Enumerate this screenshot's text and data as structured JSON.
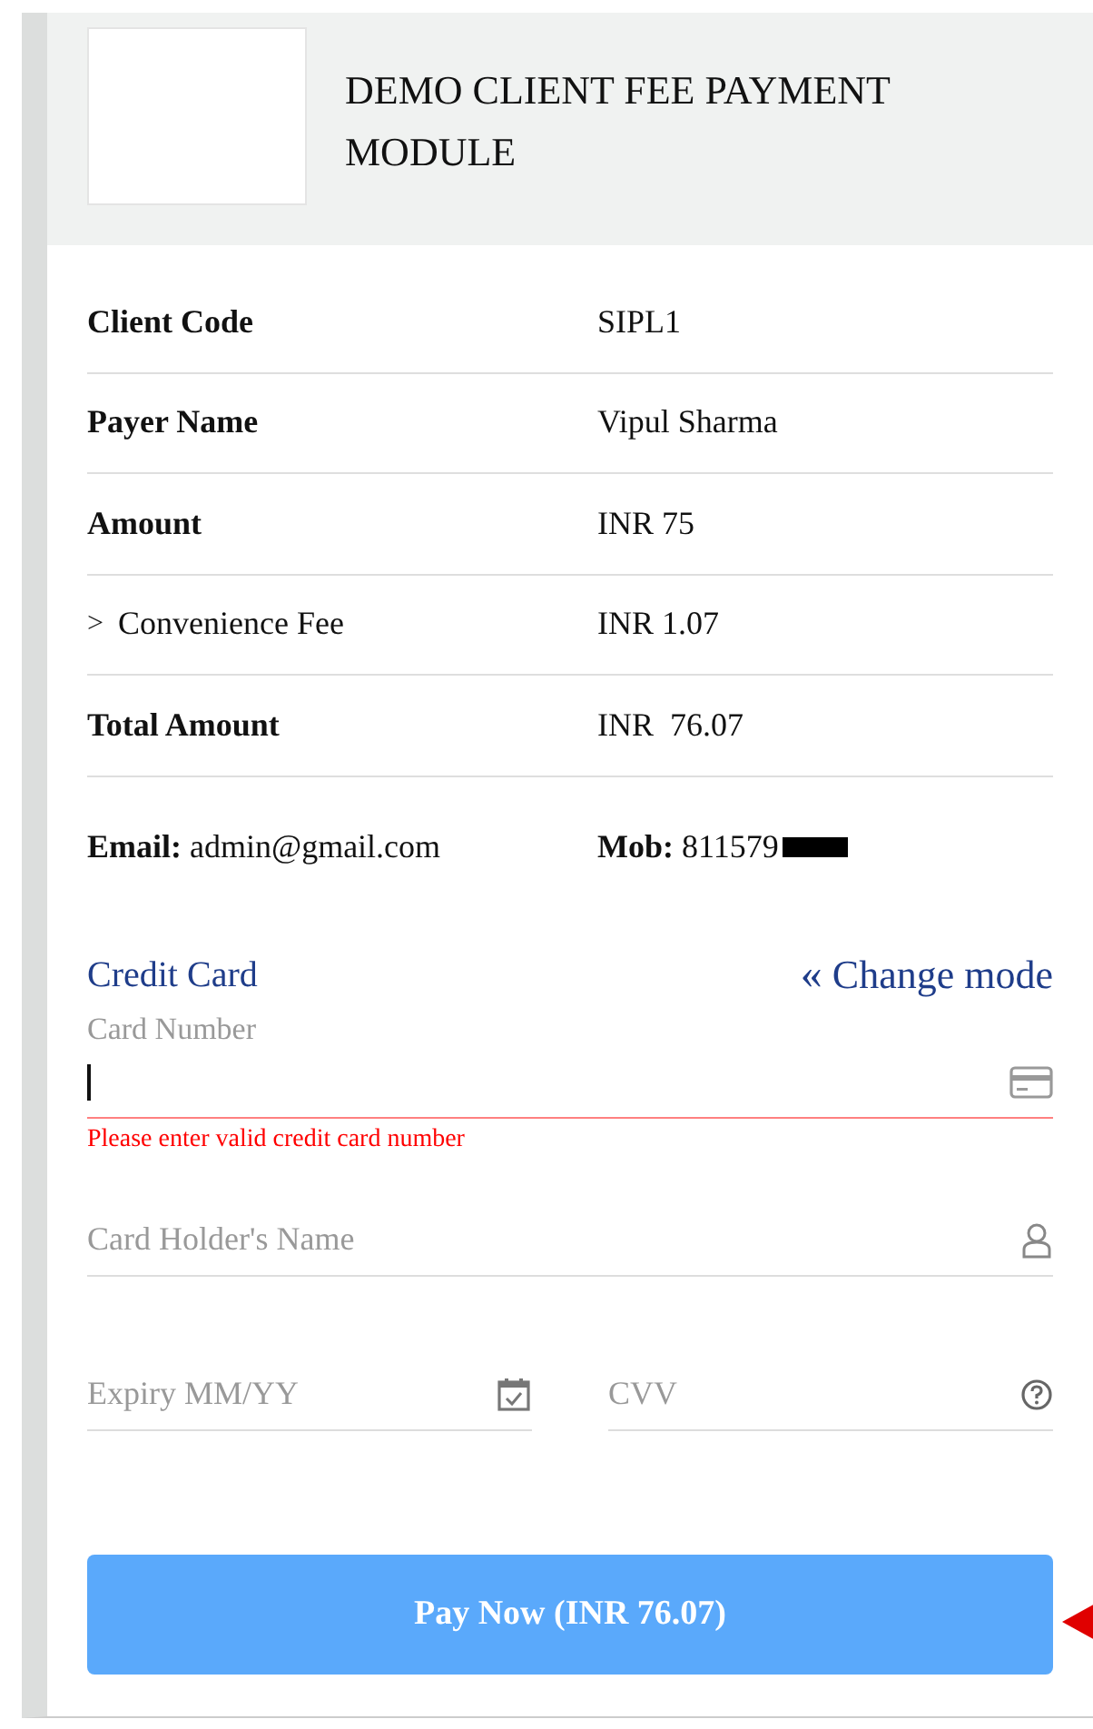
{
  "header": {
    "title": "DEMO CLIENT FEE PAYMENT MODULE"
  },
  "details": [
    {
      "kind": "plain",
      "label": "Client Code",
      "value": "SIPL1"
    },
    {
      "kind": "plain",
      "label": "Payer Name",
      "value": "Vipul Sharma"
    },
    {
      "kind": "plain",
      "label": "Amount",
      "value": "INR 75"
    },
    {
      "kind": "expandable",
      "label": "Convenience Fee",
      "value": "INR 1.07",
      "expanded": false,
      "toggle": ">"
    },
    {
      "kind": "plain",
      "label": "Total Amount",
      "value": "INR  76.07"
    }
  ],
  "contact": {
    "email_label": "Email:",
    "email": "admin@gmail.com",
    "mobile_label": "Mob:",
    "mobile": "811579",
    "mobile_redacted": true
  },
  "payment": {
    "mode": "Credit Card",
    "change_mode": "Change mode",
    "change_icon": "«",
    "card_number": {
      "label": "Card Number",
      "focused": true,
      "error": "Please enter valid credit card number"
    },
    "holder_name": {
      "placeholder": "Card Holder's Name"
    },
    "expiry": {
      "placeholder": "Expiry MM/YY"
    },
    "cvv": {
      "placeholder": "CVV"
    },
    "pay_button": "Pay Now (INR 76.07)"
  }
}
